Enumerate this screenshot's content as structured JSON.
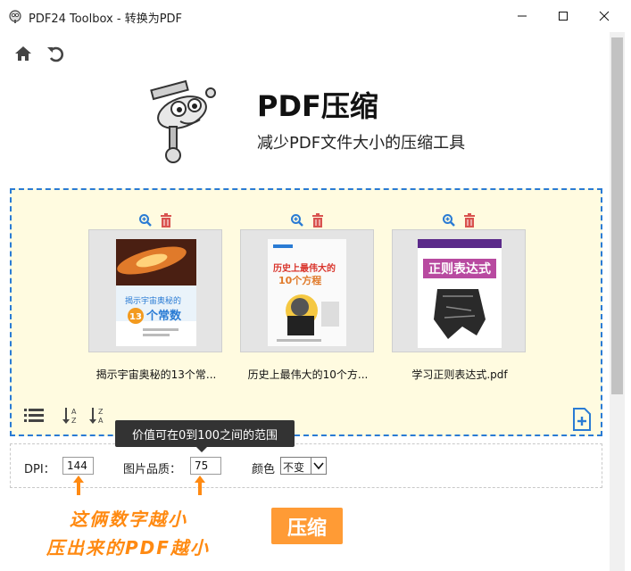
{
  "window": {
    "title": "PDF24 Toolbox - 转换为PDF"
  },
  "header": {
    "title": "PDF压缩",
    "subtitle": "减少PDF文件大小的压缩工具"
  },
  "files": [
    {
      "name": "揭示宇宙奥秘的13个常..."
    },
    {
      "name": "历史上最伟大的10个方..."
    },
    {
      "name": "学习正则表达式.pdf"
    }
  ],
  "thumbnails": {
    "book1": {
      "line1": "揭示宇宙奥秘的",
      "line2": "13",
      "line3": "个常数"
    },
    "book2": {
      "line1": "历史上最伟大的",
      "line2": "10个方程"
    },
    "book3": {
      "line1": "正则表达式"
    }
  },
  "tooltip": {
    "text": "价值可在0到100之间的范围"
  },
  "settings": {
    "dpi_label": "DPI：",
    "dpi_value": "144",
    "quality_label": "图片品质：",
    "quality_value": "75",
    "color_label": "颜色",
    "color_value": "不变"
  },
  "annotation": {
    "line1": "这俩数字越小",
    "line2": "压出来的PDF越小"
  },
  "actions": {
    "compress": "压缩"
  },
  "colors": {
    "accent": "#2a7bd4",
    "orange": "#ff9b35",
    "dropzone_bg": "#fffbe0",
    "delete": "#d9534f"
  }
}
